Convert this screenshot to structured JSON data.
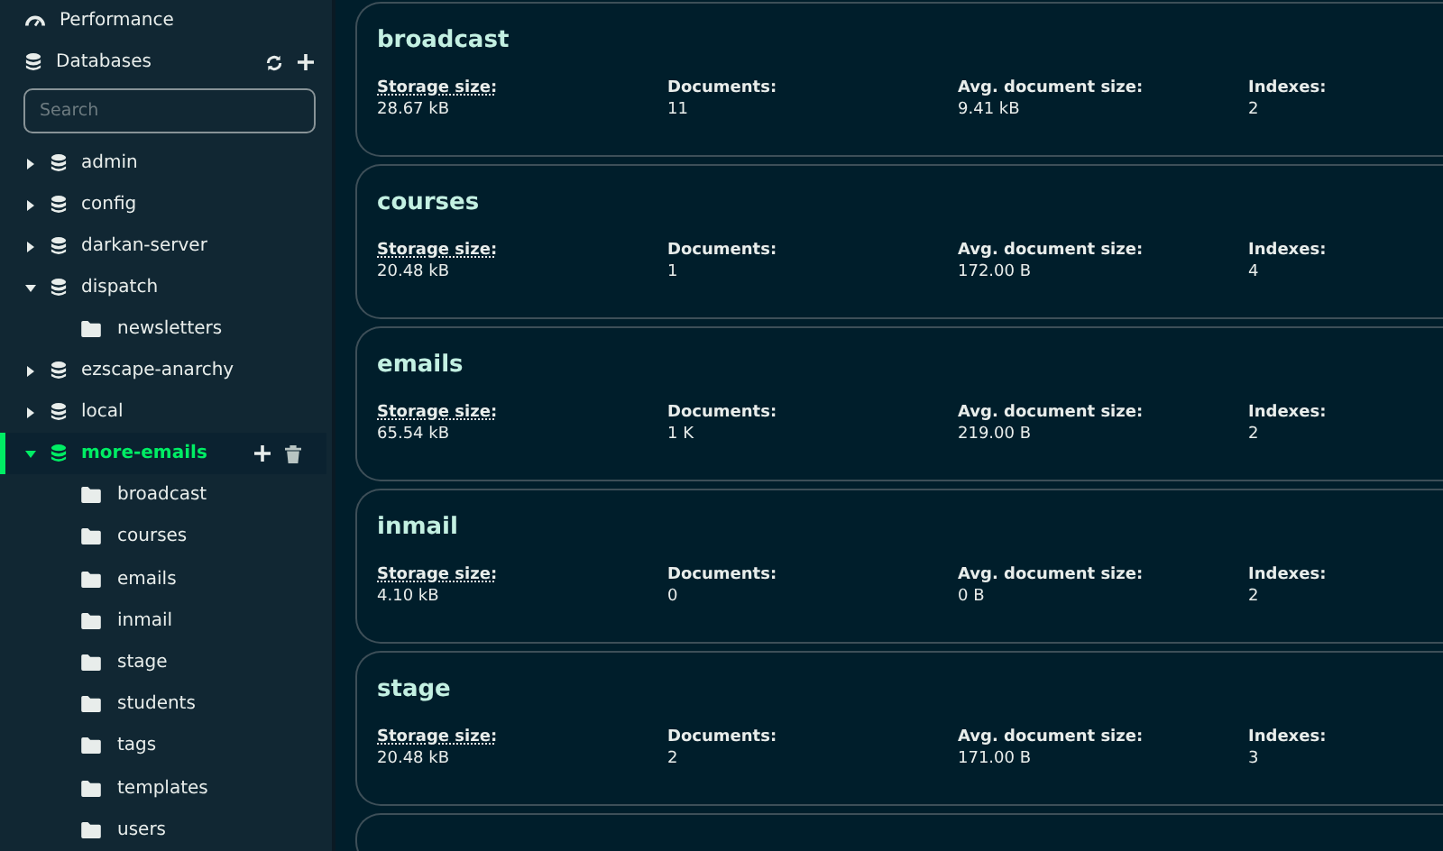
{
  "sidebar": {
    "performance": {
      "label": "Performance"
    },
    "databases_header": {
      "label": "Databases"
    },
    "search": {
      "placeholder": "Search"
    },
    "databases": [
      {
        "name": "admin",
        "expanded": false,
        "selected": false
      },
      {
        "name": "config",
        "expanded": false,
        "selected": false
      },
      {
        "name": "darkan-server",
        "expanded": false,
        "selected": false
      },
      {
        "name": "dispatch",
        "expanded": true,
        "selected": false,
        "children": [
          {
            "name": "newsletters"
          }
        ]
      },
      {
        "name": "ezscape-anarchy",
        "expanded": false,
        "selected": false
      },
      {
        "name": "local",
        "expanded": false,
        "selected": false
      },
      {
        "name": "more-emails",
        "expanded": true,
        "selected": true,
        "children": [
          {
            "name": "broadcast"
          },
          {
            "name": "courses"
          },
          {
            "name": "emails"
          },
          {
            "name": "inmail"
          },
          {
            "name": "stage"
          },
          {
            "name": "students"
          },
          {
            "name": "tags"
          },
          {
            "name": "templates"
          },
          {
            "name": "users"
          }
        ]
      }
    ]
  },
  "collections": [
    {
      "name": "broadcast",
      "stats": [
        {
          "label": "Storage size:",
          "value": "28.67 kB",
          "underlined": true
        },
        {
          "label": "Documents:",
          "value": "11",
          "underlined": false
        },
        {
          "label": "Avg. document size:",
          "value": "9.41 kB",
          "underlined": false
        },
        {
          "label": "Indexes:",
          "value": "2",
          "underlined": false
        }
      ]
    },
    {
      "name": "courses",
      "stats": [
        {
          "label": "Storage size:",
          "value": "20.48 kB",
          "underlined": true
        },
        {
          "label": "Documents:",
          "value": "1",
          "underlined": false
        },
        {
          "label": "Avg. document size:",
          "value": "172.00 B",
          "underlined": false
        },
        {
          "label": "Indexes:",
          "value": "4",
          "underlined": false
        }
      ]
    },
    {
      "name": "emails",
      "stats": [
        {
          "label": "Storage size:",
          "value": "65.54 kB",
          "underlined": true
        },
        {
          "label": "Documents:",
          "value": "1 K",
          "underlined": false
        },
        {
          "label": "Avg. document size:",
          "value": "219.00 B",
          "underlined": false
        },
        {
          "label": "Indexes:",
          "value": "2",
          "underlined": false
        }
      ]
    },
    {
      "name": "inmail",
      "stats": [
        {
          "label": "Storage size:",
          "value": "4.10 kB",
          "underlined": true
        },
        {
          "label": "Documents:",
          "value": "0",
          "underlined": false
        },
        {
          "label": "Avg. document size:",
          "value": "0 B",
          "underlined": false
        },
        {
          "label": "Indexes:",
          "value": "2",
          "underlined": false
        }
      ]
    },
    {
      "name": "stage",
      "stats": [
        {
          "label": "Storage size:",
          "value": "20.48 kB",
          "underlined": true
        },
        {
          "label": "Documents:",
          "value": "2",
          "underlined": false
        },
        {
          "label": "Avg. document size:",
          "value": "171.00 B",
          "underlined": false
        },
        {
          "label": "Indexes:",
          "value": "3",
          "underlined": false
        }
      ]
    }
  ]
}
